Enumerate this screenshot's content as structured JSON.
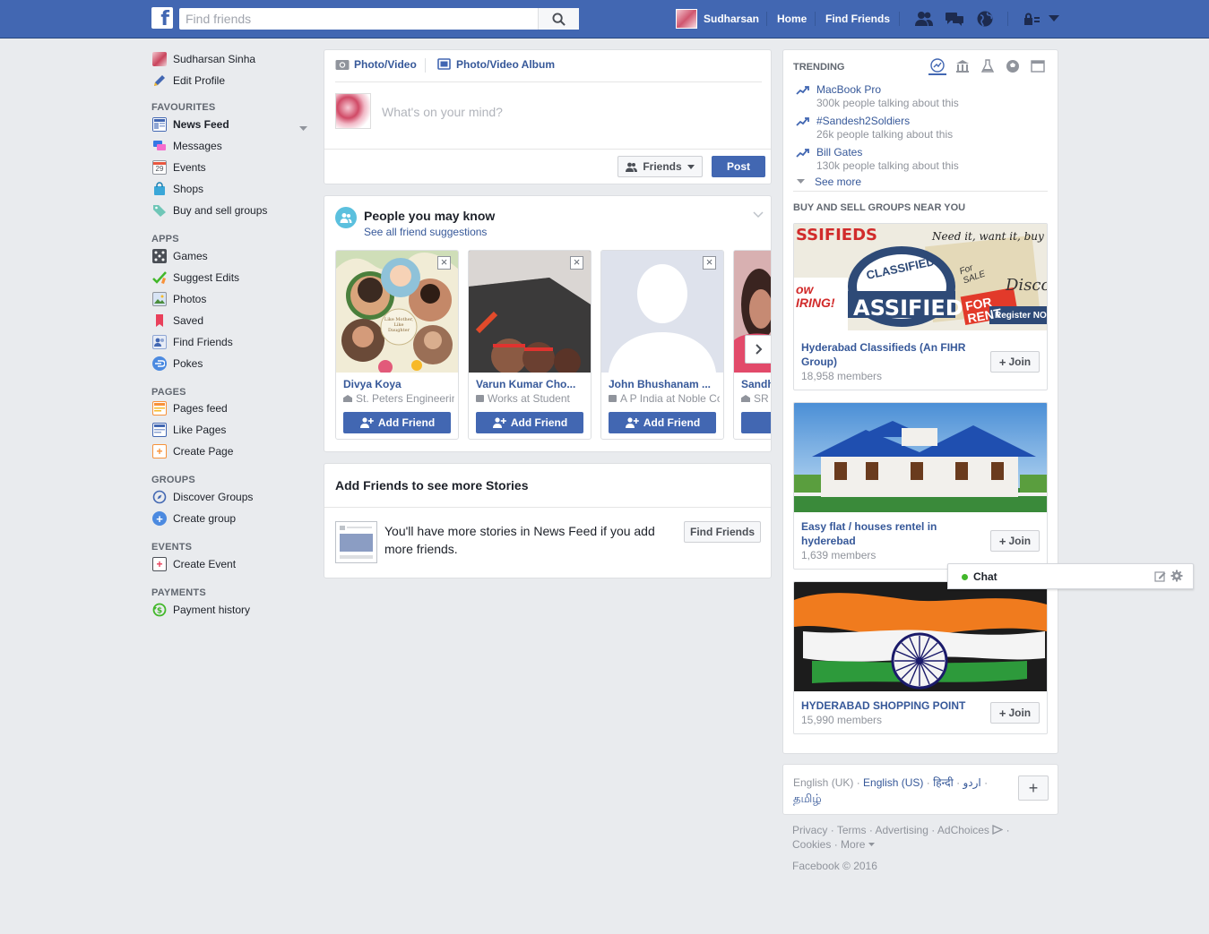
{
  "colors": {
    "brand": "#4267b2",
    "link": "#365899",
    "muted": "#90949c",
    "bg": "#e9ebee"
  },
  "topbar": {
    "search_placeholder": "Find friends",
    "user_name": "Sudharsan",
    "home": "Home",
    "find_friends": "Find Friends",
    "icons": [
      "friend-requests-icon",
      "messages-icon",
      "notifications-globe-icon",
      "privacy-lock-icon",
      "account-menu-icon"
    ]
  },
  "sidebar": {
    "profile_name": "Sudharsan Sinha",
    "edit_profile": "Edit Profile",
    "favourites_heading": "FAVOURITES",
    "favourites": [
      "News Feed",
      "Messages",
      "Events",
      "Shops",
      "Buy and sell groups"
    ],
    "events_badge": "29",
    "apps_heading": "APPS",
    "apps": [
      "Games",
      "Suggest Edits",
      "Photos",
      "Saved",
      "Find Friends",
      "Pokes"
    ],
    "pages_heading": "PAGES",
    "pages": [
      "Pages feed",
      "Like Pages",
      "Create Page"
    ],
    "groups_heading": "GROUPS",
    "groups": [
      "Discover Groups",
      "Create group"
    ],
    "events_heading": "EVENTS",
    "events": [
      "Create Event"
    ],
    "payments_heading": "PAYMENTS",
    "payments": [
      "Payment history"
    ]
  },
  "composer": {
    "photo_video": "Photo/Video",
    "photo_album": "Photo/Video Album",
    "placeholder": "What's on your mind?",
    "audience": "Friends",
    "post": "Post"
  },
  "pymk": {
    "title": "People you may know",
    "see_all": "See all friend suggestions",
    "add_friend": "Add Friend",
    "people": [
      {
        "name": "Divya Koya",
        "work": "St. Peters Engineering"
      },
      {
        "name": "Varun Kumar Cho...",
        "work": "Works at Student"
      },
      {
        "name": "John Bhushanam ...",
        "work": "A P India at Noble Col"
      },
      {
        "name": "Sandh",
        "work": "SR"
      }
    ],
    "photo_caption": "Like Mother, Like Daughter"
  },
  "stories": {
    "title": "Add Friends to see more Stories",
    "message": "You'll have more stories in News Feed if you add more friends.",
    "button": "Find Friends"
  },
  "trending": {
    "heading": "TRENDING",
    "items": [
      {
        "title": "MacBook Pro",
        "sub": "300k people talking about this"
      },
      {
        "title": "#Sandesh2Soldiers",
        "sub": "26k people talking about this"
      },
      {
        "title": "Bill Gates",
        "sub": "130k people talking about this"
      }
    ],
    "see_more": "See more"
  },
  "groups_near": {
    "heading": "BUY AND SELL GROUPS NEAR YOU",
    "join": "Join",
    "items": [
      {
        "name": "Hyderabad Classifieds (An FIHR Group)",
        "members": "18,958 members"
      },
      {
        "name": "Easy flat / houses rentel in hyderebad",
        "members": "1,639 members"
      },
      {
        "name": "HYDERABAD SHOPPING POINT",
        "members": "15,990 members"
      }
    ],
    "banner_text": {
      "ssifieds": "SSIFIEDS",
      "tagline": "Need it, want it, buy it,",
      "classified": "CLASSIFIED",
      "assified": "ASSIFIED",
      "hiring": "ow IRING!",
      "for_sale": "For SALE",
      "for_rent": "FOR RENT",
      "register": "Register NO",
      "discount": "Discou"
    }
  },
  "chat": {
    "label": "Chat"
  },
  "languages": {
    "current": "English (UK)",
    "others": [
      "English (US)",
      "हिन्दी",
      "اردو"
    ],
    "last": "தமிழ்",
    "add": "+"
  },
  "footer": {
    "links": [
      "Privacy",
      "Terms",
      "Advertising",
      "AdChoices",
      "Cookies",
      "More"
    ],
    "copyright": "Facebook © 2016"
  }
}
